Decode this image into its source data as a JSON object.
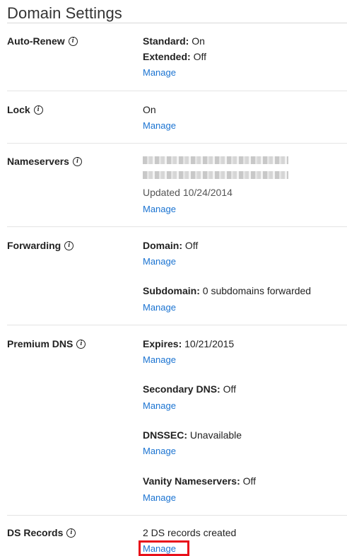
{
  "header": {
    "title": "Domain Settings"
  },
  "info_icon_glyph": "i",
  "auto_renew": {
    "label": "Auto-Renew",
    "standard_key": "Standard:",
    "standard_val": " On",
    "extended_key": "Extended:",
    "extended_val": " Off",
    "manage": "Manage"
  },
  "lock": {
    "label": "Lock",
    "value": "On",
    "manage": "Manage"
  },
  "nameservers": {
    "label": "Nameservers",
    "updated": "Updated 10/24/2014",
    "manage": "Manage"
  },
  "forwarding": {
    "label": "Forwarding",
    "domain_key": "Domain:",
    "domain_val": " Off",
    "manage_domain": "Manage",
    "subdomain_key": "Subdomain:",
    "subdomain_val": " 0 subdomains forwarded",
    "manage_subdomain": "Manage"
  },
  "premium_dns": {
    "label": "Premium DNS",
    "expires_key": "Expires:",
    "expires_val": " 10/21/2015",
    "manage_expires": "Manage",
    "secondary_key": "Secondary DNS:",
    "secondary_val": " Off",
    "manage_secondary": "Manage",
    "dnssec_key": "DNSSEC:",
    "dnssec_val": " Unavailable",
    "manage_dnssec": "Manage",
    "vanity_key": "Vanity Nameservers:",
    "vanity_val": " Off",
    "manage_vanity": "Manage"
  },
  "ds_records": {
    "label": "DS Records",
    "value": "2 DS records created",
    "manage": "Manage"
  },
  "colors": {
    "link": "#1a73d1",
    "highlight": "#e8101a"
  }
}
